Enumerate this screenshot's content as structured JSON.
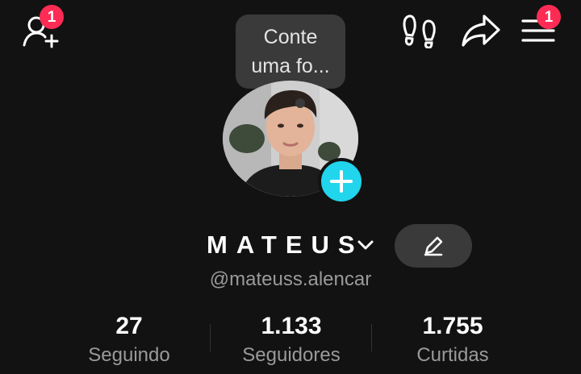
{
  "header": {
    "add_friends_badge": "1",
    "menu_badge": "1"
  },
  "tooltip": {
    "line1": "Conte",
    "line2": "uma fo..."
  },
  "profile": {
    "display_name": "MATEUS",
    "username": "@mateuss.alencar"
  },
  "stats": [
    {
      "value": "27",
      "label": "Seguindo"
    },
    {
      "value": "1.133",
      "label": "Seguidores"
    },
    {
      "value": "1.755",
      "label": "Curtidas"
    }
  ],
  "colors": {
    "background": "#121212",
    "badge": "#fe2c55",
    "add_button": "#20d5ec",
    "secondary_text": "#9a9a9a"
  },
  "icons": {
    "add_friends": "add-user-icon",
    "footprints": "footprints-icon",
    "share": "share-icon",
    "menu": "menu-icon",
    "add_photo": "plus-icon",
    "switch_account": "chevron-down-icon",
    "edit": "pencil-icon"
  }
}
